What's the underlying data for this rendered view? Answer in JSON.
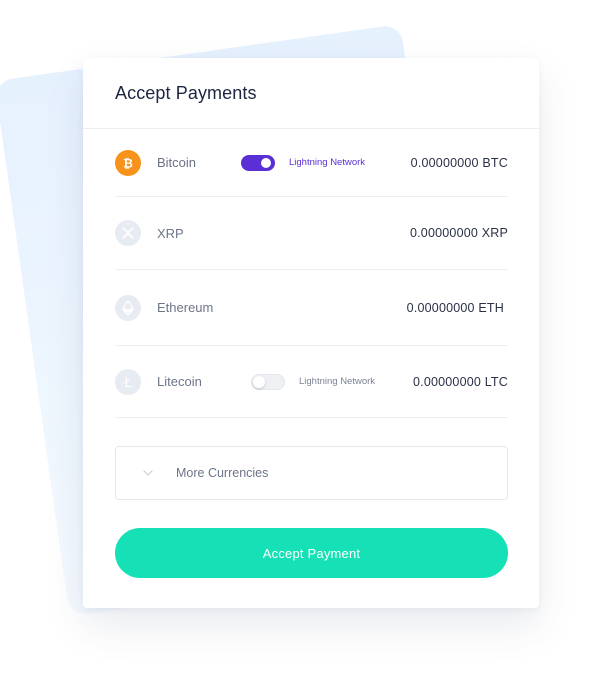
{
  "header": {
    "title": "Accept Payments"
  },
  "currencies": [
    {
      "name": "Bitcoin",
      "icon": "bitcoin-icon",
      "lightning": {
        "enabled": true,
        "label": "Lightning Network"
      },
      "amount": "0.00000000 BTC"
    },
    {
      "name": "XRP",
      "icon": "xrp-icon",
      "amount": "0.00000000 XRP"
    },
    {
      "name": "Ethereum",
      "icon": "ethereum-icon",
      "amount": "0.00000000 ETH"
    },
    {
      "name": "Litecoin",
      "icon": "litecoin-icon",
      "lightning": {
        "enabled": false,
        "label": "Lightning Network"
      },
      "amount": "0.00000000 LTC"
    }
  ],
  "more": {
    "label": "More Currencies",
    "icon": "chevron-down-icon"
  },
  "cta": {
    "label": "Accept Payment"
  },
  "colors": {
    "accent": "#16e0b5",
    "toggle_on": "#5a2fd6",
    "bitcoin": "#f7931a",
    "title": "#1c2541"
  }
}
